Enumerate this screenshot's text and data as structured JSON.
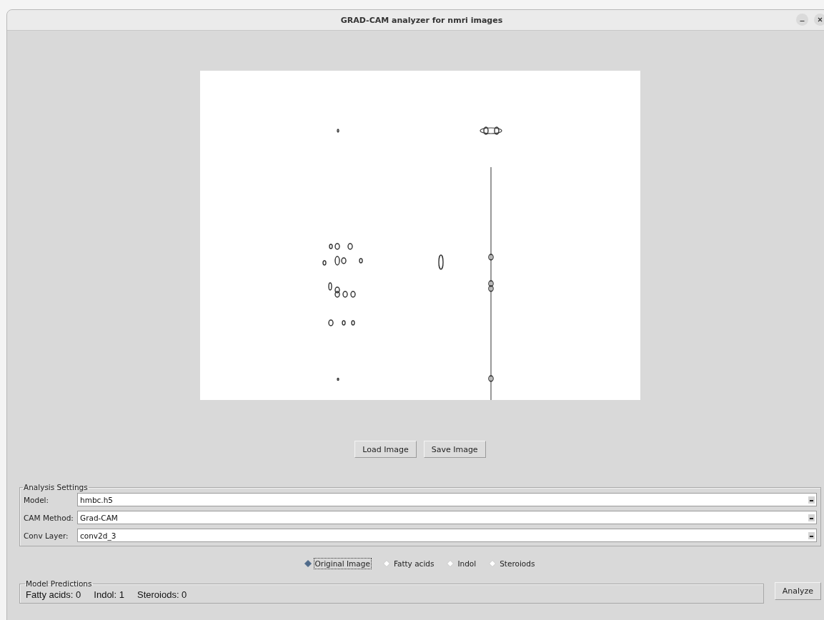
{
  "window": {
    "title": "GRAD-CAM analyzer for nmri images"
  },
  "image_actions": [
    "Load Image",
    "Save Image"
  ],
  "analysis_settings": {
    "title": "Analysis Settings",
    "fields": [
      {
        "label": "Model:",
        "value": "hmbc.h5"
      },
      {
        "label": "CAM Method:",
        "value": "Grad-CAM"
      },
      {
        "label": "Conv Layer:",
        "value": "conv2d_3"
      }
    ]
  },
  "view_options": [
    {
      "label": "Original Image",
      "selected": true
    },
    {
      "label": "Fatty acids",
      "selected": false
    },
    {
      "label": "Indol",
      "selected": false
    },
    {
      "label": "Steroiods",
      "selected": false
    }
  ],
  "model_predictions": {
    "title": "Model Predictions",
    "items": [
      "Fatty acids: 0",
      "Indol: 1",
      "Steroiods: 0"
    ]
  },
  "analyze_button": "Analyze"
}
